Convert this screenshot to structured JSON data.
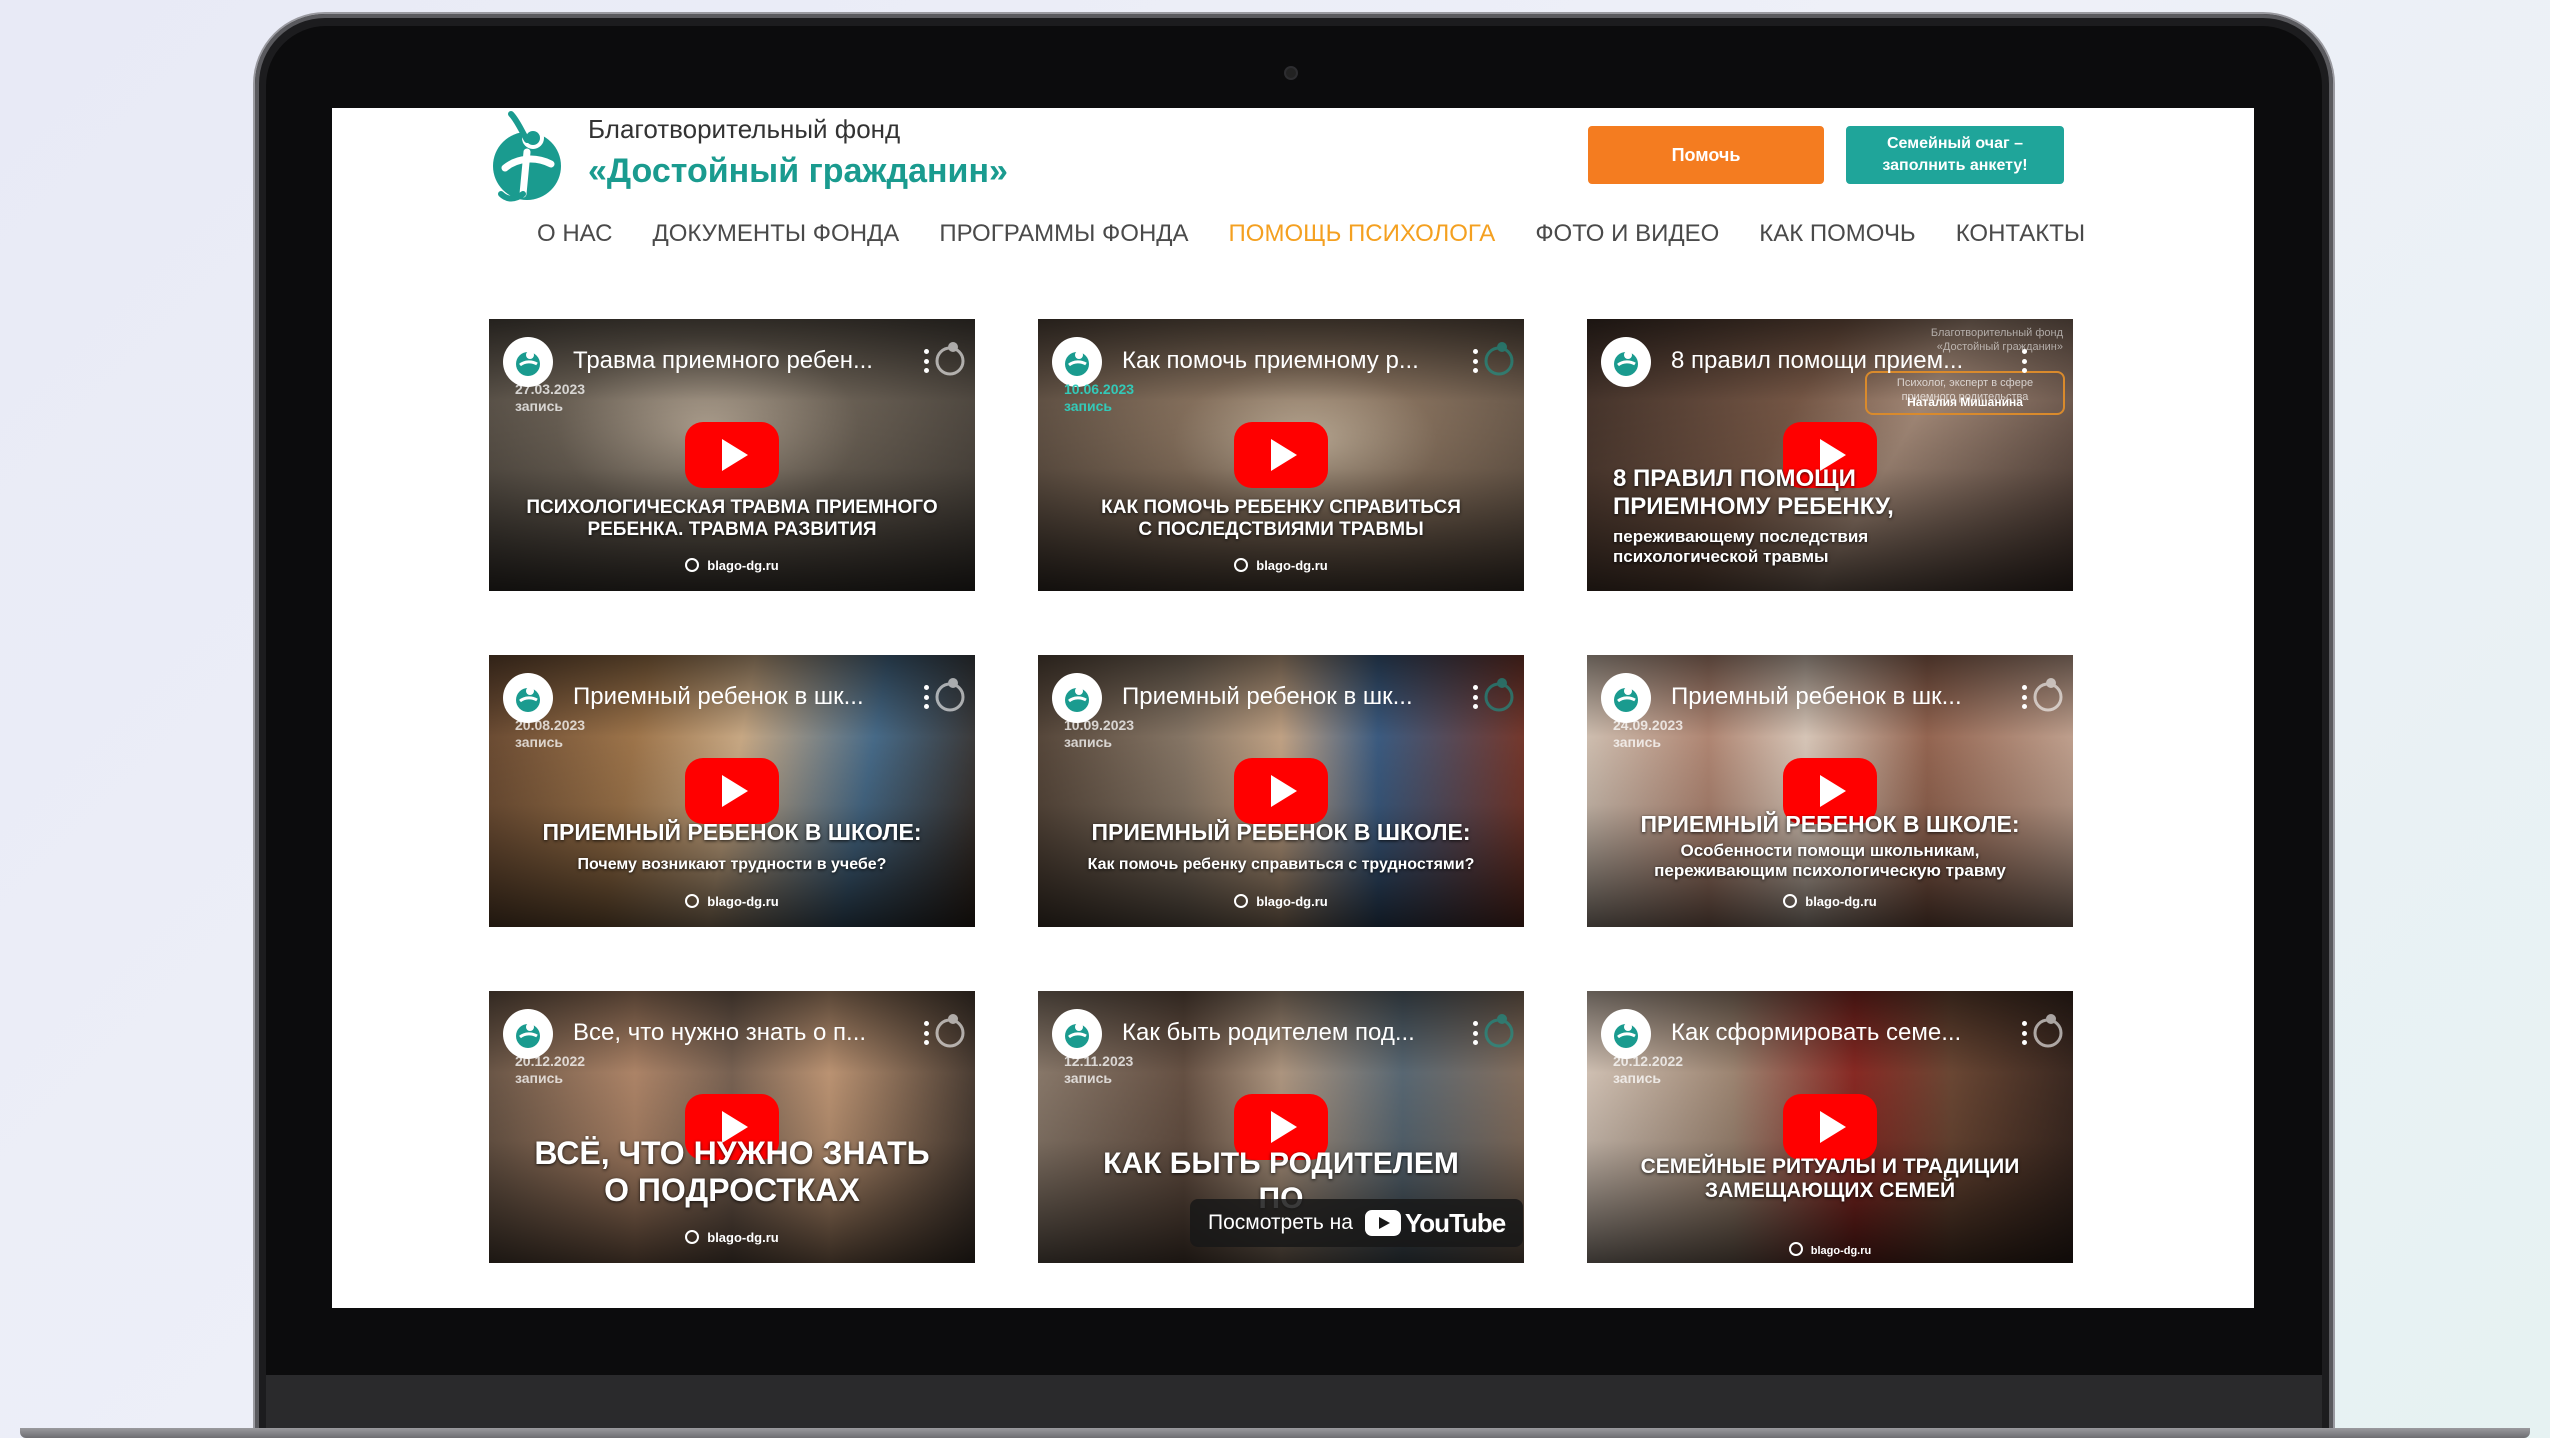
{
  "header": {
    "brand_line1": "Благотворительный фонд",
    "brand_line2": "«Достойный гражданин»",
    "help_button": "Помочь",
    "family_button": "Семейный очаг –\nзаполнить анкету!"
  },
  "nav": {
    "items": [
      "О НАС",
      "ДОКУМЕНТЫ ФОНДА",
      "ПРОГРАММЫ ФОНДА",
      "ПОМОЩЬ ПСИХОЛОГА",
      "ФОТО И ВИДЕО",
      "КАК ПОМОЧЬ",
      "КОНТАКТЫ"
    ],
    "active": "ПОМОЩЬ ПСИХОЛОГА"
  },
  "colors": {
    "accent_orange": "#f47c20",
    "accent_teal": "#1fa59a",
    "brand_teal": "#1a9b8f",
    "nav_active": "#f4a020",
    "play_red": "#ff0000"
  },
  "videos": [
    {
      "title": "Травма приемного ребен...",
      "date": "27.03.2023\nзапись",
      "caption_main": "ПСИХОЛОГИЧЕСКАЯ ТРАВМА ПРИЕМНОГО\nРЕБЕНКА. ТРАВМА РАЗВИТИЯ",
      "caption_sub": "",
      "site": "blago-dg.ru"
    },
    {
      "title": "Как помочь приемному р...",
      "date": "10.06.2023\nзапись",
      "caption_main": "КАК ПОМОЧЬ РЕБЕНКУ СПРАВИТЬСЯ\nС ПОСЛЕДСТВИЯМИ ТРАВМЫ",
      "caption_sub": "",
      "site": "blago-dg.ru"
    },
    {
      "title": "8 правил помощи прием...",
      "date": "",
      "caption_main": "8 ПРАВИЛ ПОМОЩИ\nПРИЕМНОМУ РЕБЕНКУ,",
      "caption_sub": "переживающему последствия\nпсихологической травмы",
      "site": "",
      "badge_top": "Благотворительный фонд\n«Достойный гражданин»",
      "badge_box_text": "Психолог, эксперт в сфере\nприемного родительства",
      "badge_name": "Наталия Мишанина"
    },
    {
      "title": "Приемный ребенок в шк...",
      "date": "20.08.2023\nзапись",
      "caption_main": "ПРИЕМНЫЙ РЕБЕНОК В ШКОЛЕ:",
      "caption_sub": "Почему возникают трудности в учебе?",
      "site": "blago-dg.ru"
    },
    {
      "title": "Приемный ребенок в шк...",
      "date": "10.09.2023\nзапись",
      "caption_main": "ПРИЕМНЫЙ РЕБЕНОК В ШКОЛЕ:",
      "caption_sub": "Как помочь ребенку справиться с трудностями?",
      "site": "blago-dg.ru"
    },
    {
      "title": "Приемный ребенок в шк...",
      "date": "24.09.2023\nзапись",
      "caption_main": "ПРИЕМНЫЙ РЕБЕНОК В ШКОЛЕ:",
      "caption_sub": "Особенности помощи школьникам,\nпереживающим психологическую травму",
      "site": "blago-dg.ru"
    },
    {
      "title": "Все, что нужно знать о п...",
      "date": "20.12.2022\nзапись",
      "caption_main": "ВСЁ, ЧТО НУЖНО ЗНАТЬ\nО ПОДРОСТКАХ",
      "caption_sub": "",
      "site": "blago-dg.ru"
    },
    {
      "title": "Как быть родителем под...",
      "date": "12.11.2023\nзапись",
      "caption_main": "КАК БЫТЬ РОДИТЕЛЕМ\nПО",
      "caption_sub": "",
      "site": "",
      "watch_on": "Посмотреть на",
      "watch_brand": "YouTube"
    },
    {
      "title": "Как сформировать семе...",
      "date": "20.12.2022\nзапись",
      "caption_main": "СЕМЕЙНЫЕ РИТУАЛЫ И ТРАДИЦИИ\nЗАМЕЩАЮЩИХ СЕМЕЙ",
      "caption_sub": "",
      "site": "blago-dg.ru"
    }
  ]
}
